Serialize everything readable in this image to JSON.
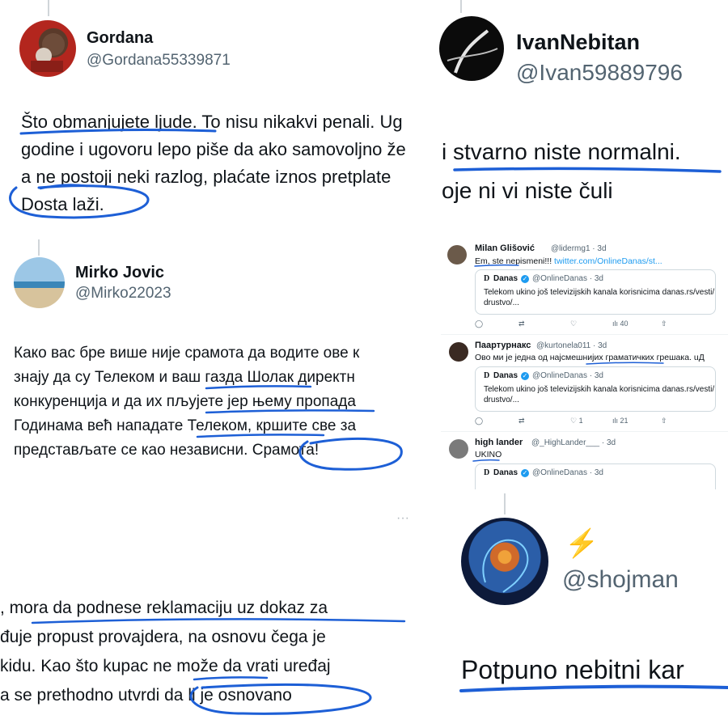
{
  "panel1": {
    "display_name": "Gordana",
    "handle": "@Gordana55339871",
    "lines": [
      "Što obmanjujete ljude. To nisu nikakvi penali. Ug",
      "godine i ugovoru lepo piše da ako samovoljno že",
      "a ne postoji neki razlog, plaćate iznos pretplate",
      "Dosta laži."
    ]
  },
  "panel2": {
    "display_name": "IvanNebitan",
    "handle": "@Ivan59889796",
    "lines": [
      "i stvarno niste normalni.",
      "oje ni vi niste čuli"
    ]
  },
  "panel3": {
    "display_name": "Mirko Jovic",
    "handle": "@Mirko22023",
    "lines": [
      "Како вас бре више није срамота да водите ове к",
      "знају да су Телеком и ваш газда Шолак директн",
      "конкуренција и да их пљујете јер њему пропада",
      "Годинама већ нападате Телеком, кршите све за",
      "представљате се као независни. Срамота!"
    ]
  },
  "panel4": {
    "reply1": {
      "name": "Milan Glišović",
      "handle_time": "@lidermg1 · 3d",
      "text": "Em, ste nepismeni!!! ",
      "link": "twitter.com/OnlineDanas/st...",
      "quote": {
        "logo": "D",
        "name": "Danas",
        "handle_time": "@OnlineDanas · 3d",
        "text_lines": [
          "Telekom ukino još televizijskih kanala korisnicima danas.rs/vesti/",
          "drustvo/..."
        ]
      },
      "actions": {
        "replies": "",
        "retweets": "",
        "likes": "",
        "views": "40"
      }
    },
    "reply2": {
      "name": "Паартурнакс",
      "handle_time": "@kurtonela011 · 3d",
      "text": "Ово ми је једна од најсмешнијих граматичких грешака. uД",
      "quote": {
        "logo": "D",
        "name": "Danas",
        "handle_time": "@OnlineDanas · 3d",
        "text_lines": [
          "Telekom ukino još televizijskih kanala korisnicima danas.rs/vesti/",
          "drustvo/..."
        ]
      },
      "actions": {
        "replies": "",
        "retweets": "",
        "likes": "1",
        "views": "21"
      }
    },
    "reply3": {
      "name": "high lander",
      "handle_time": "@_HighLander___ · 3d",
      "text": "UKINO",
      "quote": {
        "logo": "D",
        "name": "Danas",
        "handle_time": "@OnlineDanas · 3d"
      }
    }
  },
  "panel5": {
    "menu": "···",
    "lines": [
      ", mora da podnese reklamaciju uz dokaz za",
      "đuje propust provajdera, na osnovu čega je",
      "kidu. Kao što kupac ne može da vrati uređaj",
      "a se prethodno utvrdi da li je osnovano"
    ]
  },
  "panel6": {
    "emoji": "⚡",
    "handle": "@shojman",
    "text": "Potpuno nebitni kar"
  },
  "colors": {
    "ink": "#1d5fd6",
    "link": "#1d9bf0",
    "muted": "#536471"
  }
}
